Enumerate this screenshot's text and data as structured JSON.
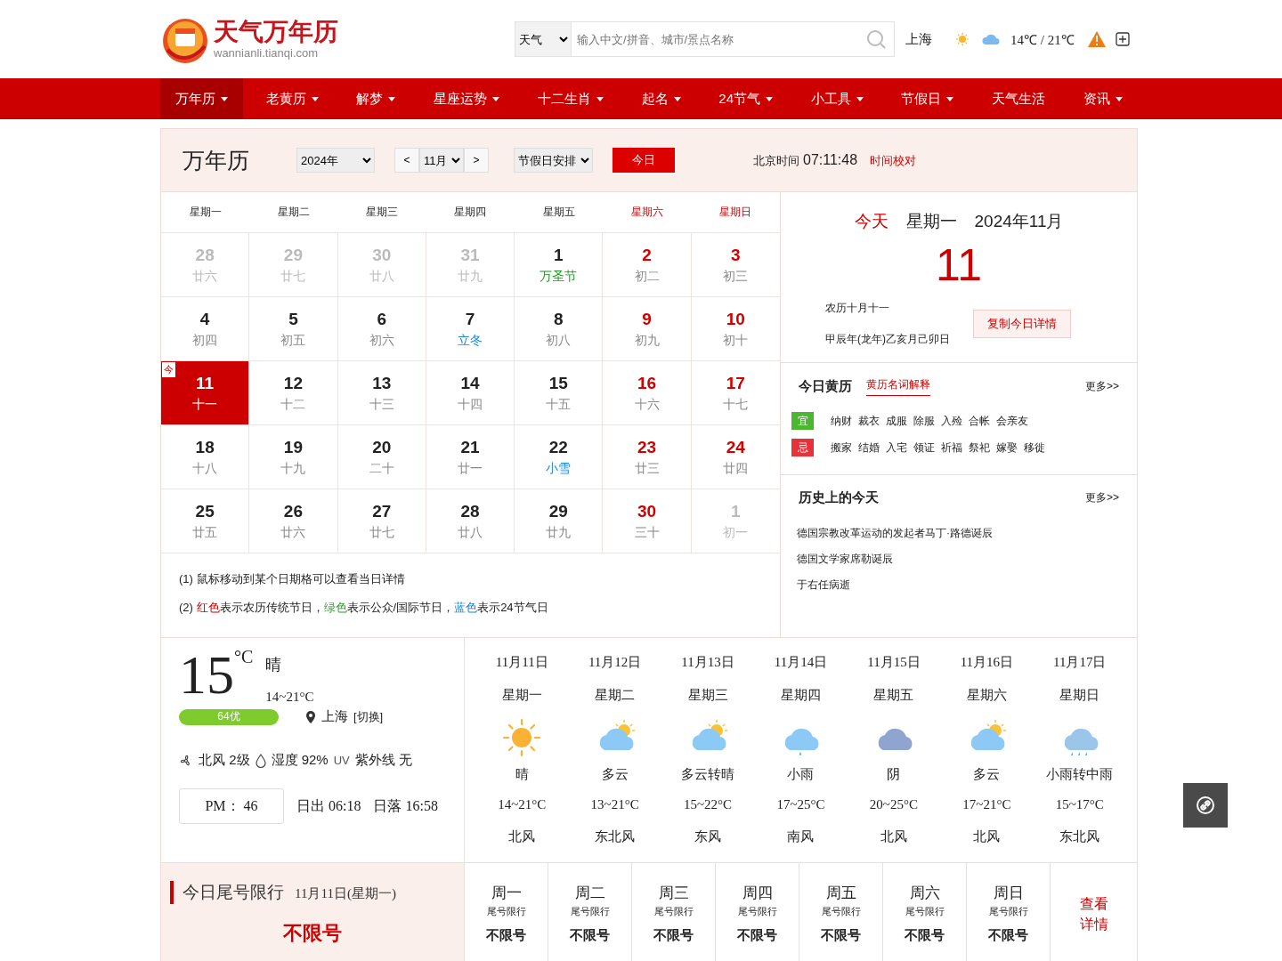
{
  "header": {
    "logo_title": "天气万年历",
    "logo_domain": "wannianli.tianqi.com",
    "search": {
      "scope": "天气",
      "placeholder": "输入中文/拼音、城市/景点名称"
    },
    "city": "上海",
    "temp_range": "14℃ / 21℃"
  },
  "nav": [
    {
      "label": "万年历",
      "selected": true,
      "dropdown": true
    },
    {
      "label": "老黄历",
      "selected": false,
      "dropdown": true
    },
    {
      "label": "解梦",
      "selected": false,
      "dropdown": true
    },
    {
      "label": "星座运势",
      "selected": false,
      "dropdown": true
    },
    {
      "label": "十二生肖",
      "selected": false,
      "dropdown": true
    },
    {
      "label": "起名",
      "selected": false,
      "dropdown": true
    },
    {
      "label": "24节气",
      "selected": false,
      "dropdown": true
    },
    {
      "label": "小工具",
      "selected": false,
      "dropdown": true
    },
    {
      "label": "节假日",
      "selected": false,
      "dropdown": true
    },
    {
      "label": "天气生活",
      "selected": false,
      "dropdown": false
    },
    {
      "label": "资讯",
      "selected": false,
      "dropdown": true
    }
  ],
  "calendar": {
    "title": "万年历",
    "year": "2024年",
    "prev": "<",
    "month": "11月",
    "next": ">",
    "holiday_select": "节假日安排",
    "today_button": "今日",
    "clock_label": "北京时间",
    "clock": "07:11:48",
    "clock_link": "时间校对",
    "weekdays": [
      {
        "label": "星期一",
        "weekend": false
      },
      {
        "label": "星期二",
        "weekend": false
      },
      {
        "label": "星期三",
        "weekend": false
      },
      {
        "label": "星期四",
        "weekend": false
      },
      {
        "label": "星期五",
        "weekend": false
      },
      {
        "label": "星期六",
        "weekend": true
      },
      {
        "label": "星期日",
        "weekend": true
      }
    ],
    "weeks": [
      [
        {
          "day": "28",
          "lunar": "廿六",
          "other_month": true,
          "selected": false
        },
        {
          "day": "29",
          "lunar": "廿七",
          "other_month": true,
          "selected": false
        },
        {
          "day": "30",
          "lunar": "廿八",
          "other_month": true,
          "selected": false
        },
        {
          "day": "31",
          "lunar": "廿九",
          "other_month": true,
          "selected": false
        },
        {
          "day": "1",
          "lunar": "万圣节",
          "color": "#1c9a1c",
          "other_month": false,
          "weekend": false,
          "selected": false
        },
        {
          "day": "2",
          "lunar": "初二",
          "other_month": false,
          "weekend": true,
          "selected": false
        },
        {
          "day": "3",
          "lunar": "初三",
          "other_month": false,
          "weekend": true,
          "selected": false
        }
      ],
      [
        {
          "day": "4",
          "lunar": "初四",
          "other_month": false,
          "weekend": false,
          "selected": false
        },
        {
          "day": "5",
          "lunar": "初五",
          "other_month": false,
          "weekend": false,
          "selected": false
        },
        {
          "day": "6",
          "lunar": "初六",
          "other_month": false,
          "weekend": false,
          "selected": false
        },
        {
          "day": "7",
          "lunar": "立冬",
          "color": "#1e88d0",
          "other_month": false,
          "weekend": false,
          "selected": false
        },
        {
          "day": "8",
          "lunar": "初八",
          "other_month": false,
          "weekend": false,
          "selected": false
        },
        {
          "day": "9",
          "lunar": "初九",
          "other_month": false,
          "weekend": true,
          "selected": false
        },
        {
          "day": "10",
          "lunar": "初十",
          "other_month": false,
          "weekend": true,
          "selected": false
        }
      ],
      [
        {
          "day": "11",
          "lunar": "十一",
          "today_badge": "今",
          "other_month": false,
          "weekend": false,
          "selected": true
        },
        {
          "day": "12",
          "lunar": "十二",
          "other_month": false,
          "weekend": false,
          "selected": false
        },
        {
          "day": "13",
          "lunar": "十三",
          "other_month": false,
          "weekend": false,
          "selected": false
        },
        {
          "day": "14",
          "lunar": "十四",
          "other_month": false,
          "weekend": false,
          "selected": false
        },
        {
          "day": "15",
          "lunar": "十五",
          "other_month": false,
          "weekend": false,
          "selected": false
        },
        {
          "day": "16",
          "lunar": "十六",
          "other_month": false,
          "weekend": true,
          "selected": false
        },
        {
          "day": "17",
          "lunar": "十七",
          "other_month": false,
          "weekend": true,
          "selected": false
        }
      ],
      [
        {
          "day": "18",
          "lunar": "十八",
          "other_month": false,
          "weekend": false,
          "selected": false
        },
        {
          "day": "19",
          "lunar": "十九",
          "other_month": false,
          "weekend": false,
          "selected": false
        },
        {
          "day": "20",
          "lunar": "二十",
          "other_month": false,
          "weekend": false,
          "selected": false
        },
        {
          "day": "21",
          "lunar": "廿一",
          "other_month": false,
          "weekend": false,
          "selected": false
        },
        {
          "day": "22",
          "lunar": "小雪",
          "color": "#1e88d0",
          "other_month": false,
          "weekend": false,
          "selected": false
        },
        {
          "day": "23",
          "lunar": "廿三",
          "other_month": false,
          "weekend": true,
          "selected": false
        },
        {
          "day": "24",
          "lunar": "廿四",
          "other_month": false,
          "weekend": true,
          "selected": false
        }
      ],
      [
        {
          "day": "25",
          "lunar": "廿五",
          "other_month": false,
          "weekend": false,
          "selected": false
        },
        {
          "day": "26",
          "lunar": "廿六",
          "other_month": false,
          "weekend": false,
          "selected": false
        },
        {
          "day": "27",
          "lunar": "廿七",
          "other_month": false,
          "weekend": false,
          "selected": false
        },
        {
          "day": "28",
          "lunar": "廿八",
          "other_month": false,
          "weekend": false,
          "selected": false
        },
        {
          "day": "29",
          "lunar": "廿九",
          "other_month": false,
          "weekend": false,
          "selected": false
        },
        {
          "day": "30",
          "lunar": "三十",
          "other_month": false,
          "weekend": true,
          "selected": false
        },
        {
          "day": "1",
          "lunar": "初一",
          "other_month": true,
          "selected": false
        }
      ]
    ],
    "notes": [
      [
        {
          "text": "(1) 鼠标移动到某个日期格可以查看当日详情"
        }
      ],
      [
        {
          "text": "(2) "
        },
        {
          "text": "红色",
          "color": "#cc0000"
        },
        {
          "text": "表示农历传统节日，"
        },
        {
          "text": "绿色",
          "color": "#2e9e2e"
        },
        {
          "text": "表示公众/国际节日，"
        },
        {
          "text": "蓝色",
          "color": "#1e7fd0"
        },
        {
          "text": "表示24节气日"
        }
      ]
    ]
  },
  "today": {
    "label": "今天",
    "weekday": "星期一",
    "year_month": "2024年11月",
    "day": "11",
    "lunar": "农历十月十一",
    "ganzhi": "甲辰年(龙年)乙亥月己卯日",
    "copy_button": "复制今日详情"
  },
  "almanac": {
    "title": "今日黄历",
    "glossary_link": "黄历名词解释",
    "more": "更多>>",
    "rows": [
      {
        "kind": "good",
        "tag": "宜",
        "items": [
          "纳财",
          "裁衣",
          "成服",
          "除服",
          "入殓",
          "合帐",
          "会亲友"
        ]
      },
      {
        "kind": "bad",
        "tag": "忌",
        "items": [
          "搬家",
          "结婚",
          "入宅",
          "领证",
          "祈福",
          "祭祀",
          "嫁娶",
          "移徙"
        ]
      }
    ]
  },
  "history": {
    "title": "历史上的今天",
    "more": "更多>>",
    "events": [
      "德国宗教改革运动的发起者马丁·路德诞辰",
      "德国文学家席勒诞辰",
      "于右任病逝"
    ]
  },
  "weather": {
    "temp": "15",
    "unit": "°C",
    "condition": "晴",
    "range": "14~21°C",
    "aqi": "64优",
    "location": "上海",
    "switch": "[切换]",
    "wind": "北风 2级",
    "humidity": "湿度 92%",
    "uv_label": "UV",
    "uv": "紫外线 无",
    "pm": "PM： 46",
    "sunrise": "日出 06:18",
    "sunset": "日落 16:58",
    "forecast": [
      {
        "date": "11月11日",
        "weekday": "星期一",
        "kind": "sun",
        "condition": "晴",
        "range": "14~21°C",
        "wind": "北风"
      },
      {
        "date": "11月12日",
        "weekday": "星期二",
        "kind": "cloud-sun",
        "condition": "多云",
        "range": "13~21°C",
        "wind": "东北风"
      },
      {
        "date": "11月13日",
        "weekday": "星期三",
        "kind": "cloud-sun",
        "condition": "多云转晴",
        "range": "15~22°C",
        "wind": "东风"
      },
      {
        "date": "11月14日",
        "weekday": "星期四",
        "kind": "rain",
        "condition": "小雨",
        "range": "17~25°C",
        "wind": "南风"
      },
      {
        "date": "11月15日",
        "weekday": "星期五",
        "kind": "overcast",
        "condition": "阴",
        "range": "20~25°C",
        "wind": "北风"
      },
      {
        "date": "11月16日",
        "weekday": "星期六",
        "kind": "cloud-sun",
        "condition": "多云",
        "range": "17~21°C",
        "wind": "北风"
      },
      {
        "date": "11月17日",
        "weekday": "星期日",
        "kind": "heavy-rain",
        "condition": "小雨转中雨",
        "range": "15~17°C",
        "wind": "东北风"
      }
    ]
  },
  "traffic": {
    "title": "今日尾号限行",
    "date": "11月11日(星期一)",
    "status": "不限号",
    "details": "查看详情",
    "days": [
      {
        "day": "周一",
        "label": "尾号限行",
        "value": "不限号"
      },
      {
        "day": "周二",
        "label": "尾号限行",
        "value": "不限号"
      },
      {
        "day": "周三",
        "label": "尾号限行",
        "value": "不限号"
      },
      {
        "day": "周四",
        "label": "尾号限行",
        "value": "不限号"
      },
      {
        "day": "周五",
        "label": "尾号限行",
        "value": "不限号"
      },
      {
        "day": "周六",
        "label": "尾号限行",
        "value": "不限号"
      },
      {
        "day": "周日",
        "label": "尾号限行",
        "value": "不限号"
      }
    ]
  }
}
